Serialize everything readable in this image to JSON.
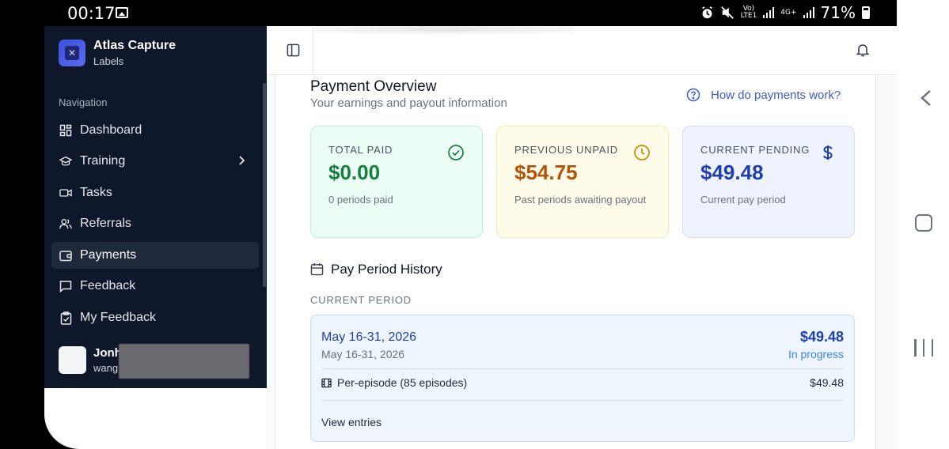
{
  "status_bar": {
    "time": "00:17",
    "volte": "Vo)\nLTE1",
    "network": "4G+",
    "battery": "71%"
  },
  "sidebar": {
    "brand_name": "Atlas Capture",
    "brand_sub": "Labels",
    "heading": "Navigation",
    "items": [
      {
        "label": "Dashboard",
        "icon": "dashboard-icon"
      },
      {
        "label": "Training",
        "icon": "graduation-cap-icon"
      },
      {
        "label": "Tasks",
        "icon": "video-icon"
      },
      {
        "label": "Referrals",
        "icon": "users-icon"
      },
      {
        "label": "Payments",
        "icon": "wallet-icon"
      },
      {
        "label": "Feedback",
        "icon": "message-icon"
      },
      {
        "label": "My Feedback",
        "icon": "clipboard-check-icon"
      }
    ],
    "active_item": "Payments",
    "user": {
      "name": "Jonh",
      "email": "wang"
    }
  },
  "overview": {
    "title": "Payment Overview",
    "subtitle": "Your earnings and payout information",
    "help_link": "How do payments work?"
  },
  "stats": {
    "total_paid": {
      "label": "TOTAL PAID",
      "value": "$0.00",
      "desc": "0 periods paid"
    },
    "previous_unpaid": {
      "label": "PREVIOUS UNPAID",
      "value": "$54.75",
      "desc": "Past periods awaiting payout"
    },
    "current_pending": {
      "label": "CURRENT PENDING",
      "value": "$49.48",
      "desc": "Current pay period"
    }
  },
  "history": {
    "title": "Pay Period History",
    "current_label": "CURRENT PERIOD",
    "period": {
      "title": "May 16-31, 2026",
      "subtitle": "May 16-31, 2026",
      "amount": "$49.48",
      "status": "In progress",
      "line_label": "Per-episode (85 episodes)",
      "line_amount": "$49.48",
      "view_entries": "View entries"
    }
  },
  "colors": {
    "sidebar_bg": "#0f172a",
    "paid_green": "#15803d",
    "unpaid_amber": "#b45309",
    "pending_blue": "#1e40af",
    "link_blue": "#3b5bcf"
  }
}
